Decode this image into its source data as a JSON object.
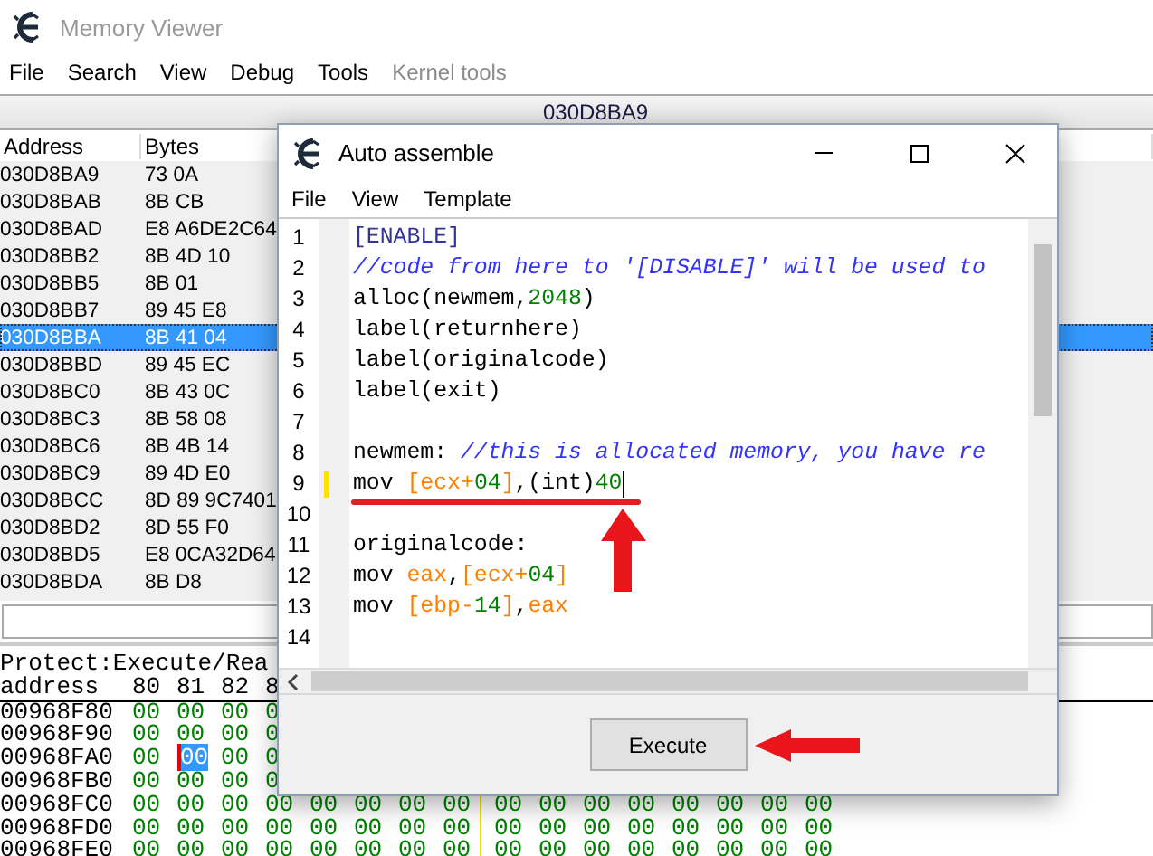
{
  "memory_viewer": {
    "title": "Memory Viewer",
    "menu": [
      {
        "label": "File",
        "disabled": false
      },
      {
        "label": "Search",
        "disabled": false
      },
      {
        "label": "View",
        "disabled": false
      },
      {
        "label": "Debug",
        "disabled": false
      },
      {
        "label": "Tools",
        "disabled": false
      },
      {
        "label": "Kernel tools",
        "disabled": true
      }
    ],
    "address_bar": "030D8BA9",
    "disassembly": {
      "columns": [
        "Address",
        "Bytes"
      ],
      "rows": [
        {
          "address": "030D8BA9",
          "bytes": "73 0A",
          "selected": false
        },
        {
          "address": "030D8BAB",
          "bytes": "8B CB",
          "selected": false
        },
        {
          "address": "030D8BAD",
          "bytes": "E8 A6DE2C64",
          "selected": false
        },
        {
          "address": "030D8BB2",
          "bytes": "8B 4D 10",
          "selected": false
        },
        {
          "address": "030D8BB5",
          "bytes": "8B 01",
          "selected": false
        },
        {
          "address": "030D8BB7",
          "bytes": "89 45 E8",
          "selected": false
        },
        {
          "address": "030D8BBA",
          "bytes": "8B 41 04",
          "selected": true
        },
        {
          "address": "030D8BBD",
          "bytes": "89 45 EC",
          "selected": false
        },
        {
          "address": "030D8BC0",
          "bytes": "8B 43 0C",
          "selected": false
        },
        {
          "address": "030D8BC3",
          "bytes": "8B 58 08",
          "selected": false
        },
        {
          "address": "030D8BC6",
          "bytes": "8B 4B 14",
          "selected": false
        },
        {
          "address": "030D8BC9",
          "bytes": "89 4D E0",
          "selected": false
        },
        {
          "address": "030D8BCC",
          "bytes": "8D 89 9C7401",
          "selected": false
        },
        {
          "address": "030D8BD2",
          "bytes": "8D 55 F0",
          "selected": false
        },
        {
          "address": "030D8BD5",
          "bytes": "E8 0CA32D64",
          "selected": false
        },
        {
          "address": "030D8BDA",
          "bytes": "8B D8",
          "selected": false
        }
      ]
    },
    "hex_view": {
      "protection": "Protect:Execute/Rea",
      "header": [
        "address",
        "80",
        "81",
        "82",
        "8"
      ],
      "rows": [
        {
          "address": "00968F80",
          "bytes": [
            {
              "value": "00",
              "selected": false
            },
            {
              "value": "00",
              "selected": false
            },
            {
              "value": "00",
              "selected": false
            },
            {
              "value": "0",
              "selected": false
            }
          ]
        },
        {
          "address": "00968F90",
          "bytes": [
            {
              "value": "00",
              "selected": false
            },
            {
              "value": "00",
              "selected": false
            },
            {
              "value": "00",
              "selected": false
            },
            {
              "value": "0",
              "selected": false
            }
          ]
        },
        {
          "address": "00968FA0",
          "bytes": [
            {
              "value": "00",
              "selected": false
            },
            {
              "value": "00",
              "selected": true
            },
            {
              "value": "00",
              "selected": false
            },
            {
              "value": "0",
              "selected": false
            }
          ]
        },
        {
          "address": "00968FB0",
          "bytes": [
            {
              "value": "00",
              "selected": false
            },
            {
              "value": "00",
              "selected": false
            },
            {
              "value": "00",
              "selected": false
            },
            {
              "value": "0",
              "selected": false
            }
          ]
        },
        {
          "address": "00968FC0",
          "bytes": [
            {
              "value": "00",
              "selected": false
            },
            {
              "value": "00",
              "selected": false
            },
            {
              "value": "00",
              "selected": false
            },
            {
              "value": "00",
              "selected": false
            },
            {
              "value": "00",
              "selected": false
            },
            {
              "value": "00",
              "selected": false
            },
            {
              "value": "00",
              "selected": false
            },
            {
              "value": "00",
              "selected": false
            },
            {
              "value": "00",
              "selected": false
            },
            {
              "value": "00",
              "selected": false
            },
            {
              "value": "00",
              "selected": false
            },
            {
              "value": "00",
              "selected": false
            },
            {
              "value": "00",
              "selected": false
            },
            {
              "value": "00",
              "selected": false
            },
            {
              "value": "00",
              "selected": false
            },
            {
              "value": "00",
              "selected": false
            }
          ]
        },
        {
          "address": "00968FD0",
          "bytes": [
            {
              "value": "00",
              "selected": false
            },
            {
              "value": "00",
              "selected": false
            },
            {
              "value": "00",
              "selected": false
            },
            {
              "value": "00",
              "selected": false
            },
            {
              "value": "00",
              "selected": false
            },
            {
              "value": "00",
              "selected": false
            },
            {
              "value": "00",
              "selected": false
            },
            {
              "value": "00",
              "selected": false
            },
            {
              "value": "00",
              "selected": false
            },
            {
              "value": "00",
              "selected": false
            },
            {
              "value": "00",
              "selected": false
            },
            {
              "value": "00",
              "selected": false
            },
            {
              "value": "00",
              "selected": false
            },
            {
              "value": "00",
              "selected": false
            },
            {
              "value": "00",
              "selected": false
            },
            {
              "value": "00",
              "selected": false
            }
          ]
        },
        {
          "address": "00968FE0",
          "bytes": [
            {
              "value": "00",
              "selected": false
            },
            {
              "value": "00",
              "selected": false
            },
            {
              "value": "00",
              "selected": false
            },
            {
              "value": "00",
              "selected": false
            },
            {
              "value": "00",
              "selected": false
            },
            {
              "value": "00",
              "selected": false
            },
            {
              "value": "00",
              "selected": false
            },
            {
              "value": "00",
              "selected": false
            },
            {
              "value": "00",
              "selected": false
            },
            {
              "value": "00",
              "selected": false
            },
            {
              "value": "00",
              "selected": false
            },
            {
              "value": "00",
              "selected": false
            },
            {
              "value": "00",
              "selected": false
            },
            {
              "value": "00",
              "selected": false
            },
            {
              "value": "00",
              "selected": false
            },
            {
              "value": "00",
              "selected": false
            }
          ]
        }
      ]
    }
  },
  "auto_assemble": {
    "title": "Auto assemble",
    "menu": [
      "File",
      "View",
      "Template"
    ],
    "lines": [
      {
        "number": "1",
        "marker": false,
        "caret": false,
        "tokens": [
          {
            "text": "[ENABLE]",
            "kind": "section"
          }
        ]
      },
      {
        "number": "2",
        "marker": false,
        "caret": false,
        "tokens": [
          {
            "text": "//code from here to '[DISABLE]' will be used to",
            "kind": "comment"
          }
        ]
      },
      {
        "number": "3",
        "marker": false,
        "caret": false,
        "tokens": [
          {
            "text": "alloc(newmem,",
            "kind": "plain"
          },
          {
            "text": "2048",
            "kind": "number"
          },
          {
            "text": ")",
            "kind": "plain"
          }
        ]
      },
      {
        "number": "4",
        "marker": false,
        "caret": false,
        "tokens": [
          {
            "text": "label(returnhere)",
            "kind": "plain"
          }
        ]
      },
      {
        "number": "5",
        "marker": false,
        "caret": false,
        "tokens": [
          {
            "text": "label(originalcode)",
            "kind": "plain"
          }
        ]
      },
      {
        "number": "6",
        "marker": false,
        "caret": false,
        "tokens": [
          {
            "text": "label(exit)",
            "kind": "plain"
          }
        ]
      },
      {
        "number": "7",
        "marker": false,
        "caret": false
      },
      {
        "number": "8",
        "marker": false,
        "caret": false,
        "tokens": [
          {
            "text": "newmem: ",
            "kind": "plain"
          },
          {
            "text": "//this is allocated memory, you have re",
            "kind": "comment"
          }
        ]
      },
      {
        "number": "9",
        "marker": true,
        "caret": true,
        "tokens": [
          {
            "text": "mov ",
            "kind": "plain"
          },
          {
            "text": "[ecx+",
            "kind": "register"
          },
          {
            "text": "04",
            "kind": "number"
          },
          {
            "text": "]",
            "kind": "register"
          },
          {
            "text": ",(int)",
            "kind": "plain"
          },
          {
            "text": "40",
            "kind": "number"
          }
        ]
      },
      {
        "number": "10",
        "marker": false,
        "caret": false
      },
      {
        "number": "11",
        "marker": false,
        "caret": false,
        "tokens": [
          {
            "text": "originalcode:",
            "kind": "plain"
          }
        ]
      },
      {
        "number": "12",
        "marker": false,
        "caret": false,
        "tokens": [
          {
            "text": "mov ",
            "kind": "plain"
          },
          {
            "text": "eax",
            "kind": "register"
          },
          {
            "text": ",",
            "kind": "plain"
          },
          {
            "text": "[ecx+",
            "kind": "register"
          },
          {
            "text": "04",
            "kind": "number"
          },
          {
            "text": "]",
            "kind": "register"
          }
        ]
      },
      {
        "number": "13",
        "marker": false,
        "caret": false,
        "tokens": [
          {
            "text": "mov ",
            "kind": "plain"
          },
          {
            "text": "[ebp-",
            "kind": "register"
          },
          {
            "text": "14",
            "kind": "number"
          },
          {
            "text": "]",
            "kind": "register"
          },
          {
            "text": ",",
            "kind": "plain"
          },
          {
            "text": "eax",
            "kind": "register"
          }
        ]
      },
      {
        "number": "14",
        "marker": false,
        "caret": false
      }
    ],
    "button": "Execute"
  }
}
